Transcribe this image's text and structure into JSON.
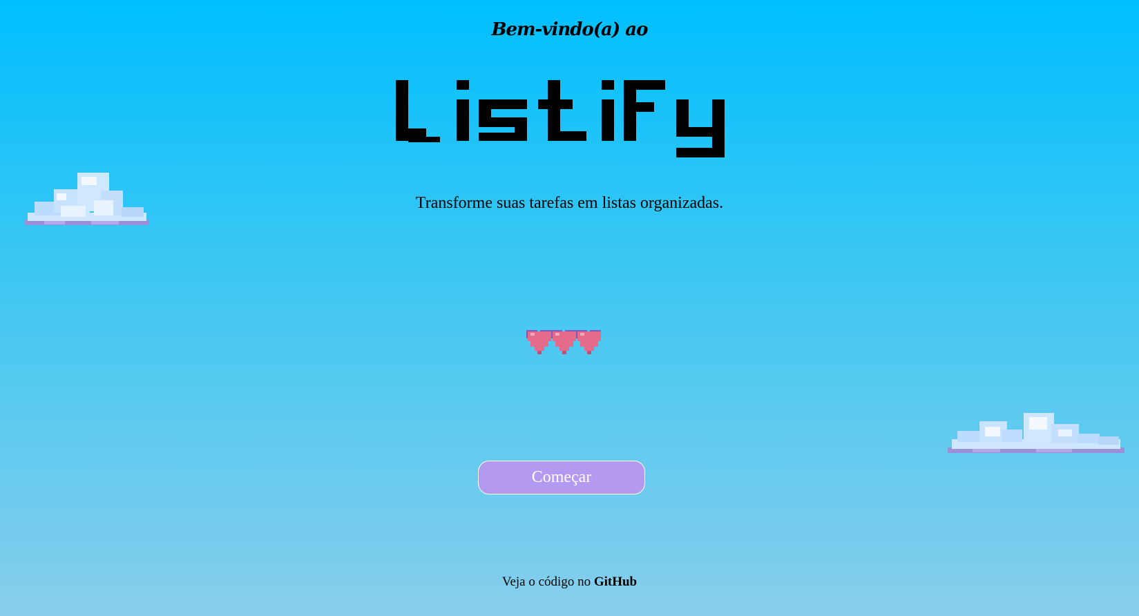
{
  "welcome_text": "Bem-vindo(a) ao",
  "app_name": "Listify",
  "tagline": "Transforme suas tarefas em listas organizadas.",
  "start_button_label": "Começar",
  "footer": {
    "prefix": "Veja o código no",
    "link_label": "GitHub"
  },
  "colors": {
    "sky_top": "#00bfff",
    "sky_bottom": "#88ceec",
    "button_bg": "#b399f0",
    "heart": "#e56b8a"
  },
  "icons": {
    "clouds": "pixel-cloud-icon",
    "hearts": "pixel-hearts-icon"
  }
}
